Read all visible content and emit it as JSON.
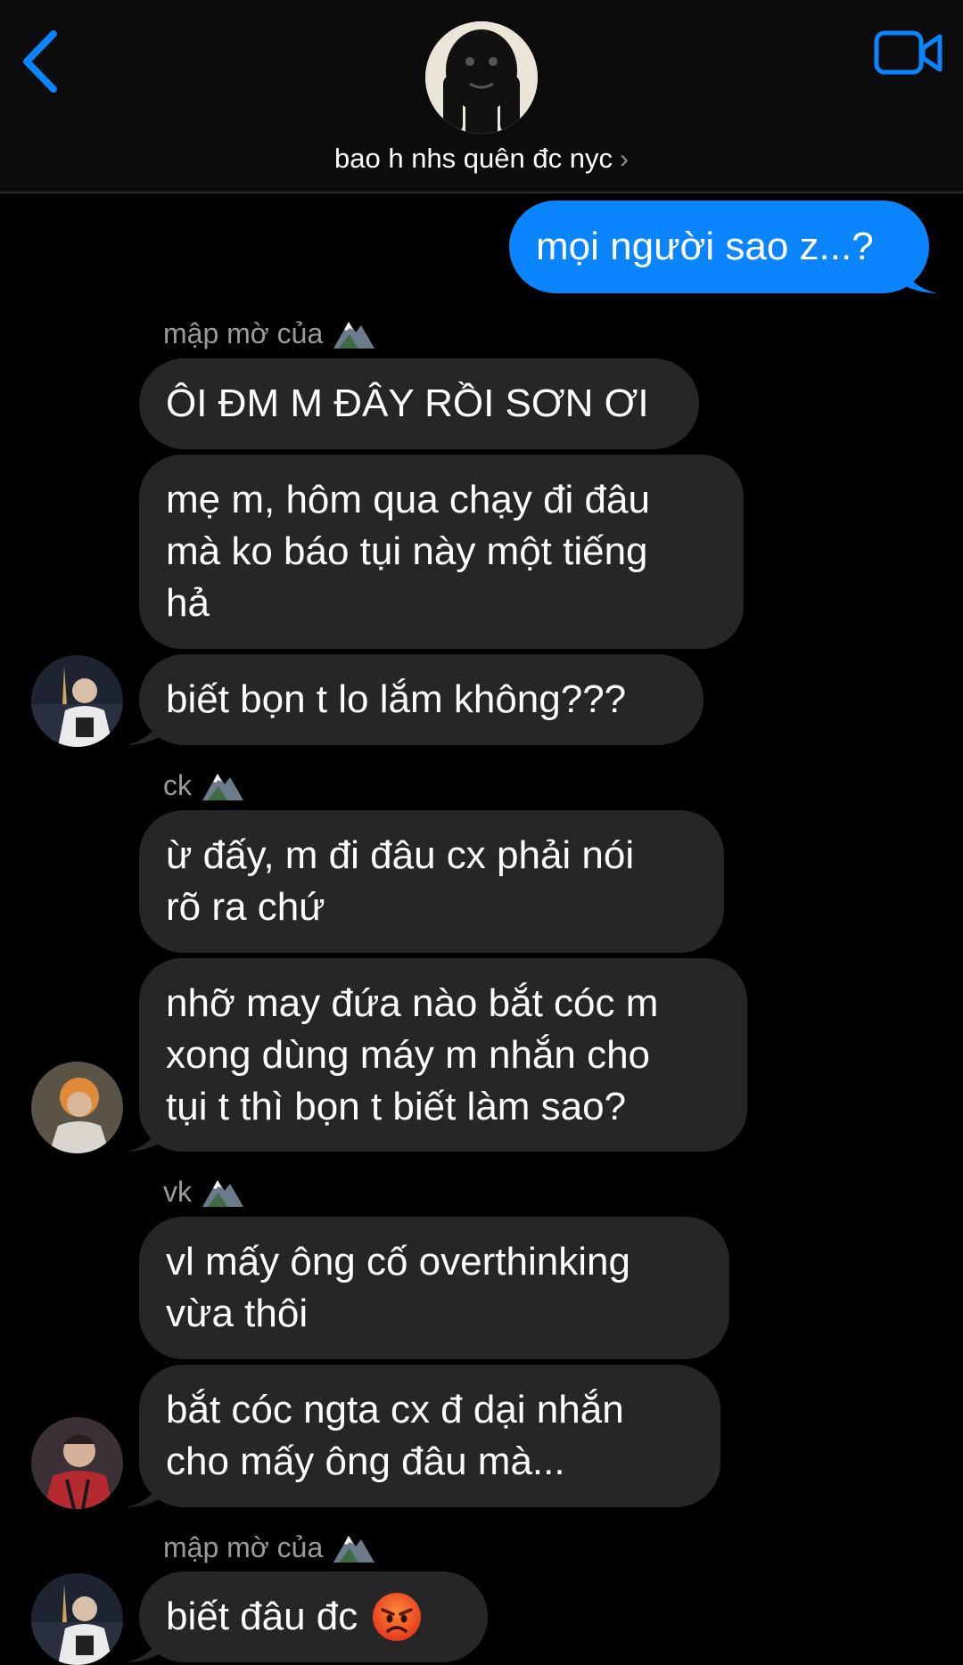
{
  "header": {
    "group_name": "bao h nhs quên đc nyc",
    "chevron": "›",
    "back_icon": "chevron-left-icon",
    "video_icon": "video-camera-icon",
    "accent_color": "#0a84ff"
  },
  "messages": [
    {
      "direction": "outgoing",
      "lines": [
        "mọi người sao z...?"
      ]
    },
    {
      "sender": "mập mờ của",
      "sender_emoji": "mountain-icon",
      "lines": [
        "ÔI ĐM M ĐÂY RỒI SƠN ƠI"
      ]
    },
    {
      "lines": [
        "mẹ m, hôm qua chạy đi đâu",
        "mà ko báo tụi này một tiếng",
        "hả"
      ]
    },
    {
      "lines": [
        "biết bọn t lo lắm không???"
      ]
    },
    {
      "sender": "ck",
      "sender_emoji": "mountain-icon",
      "lines": [
        "ừ đấy, m đi đâu cx phải nói",
        "rõ ra chứ"
      ]
    },
    {
      "lines": [
        "nhỡ may đứa nào bắt cóc m",
        "xong dùng máy m nhắn cho",
        "tụi t thì bọn t biết làm sao?"
      ]
    },
    {
      "sender": "vk",
      "sender_emoji": "mountain-icon",
      "lines": [
        "vl mấy ông cố overthinking",
        "vừa thôi"
      ]
    },
    {
      "lines": [
        "bắt cóc ngta cx đ dại nhắn",
        "cho mấy ông đâu mà..."
      ]
    },
    {
      "sender": "mập mờ của",
      "sender_emoji": "mountain-icon",
      "lines": [
        "biết đâu đc"
      ],
      "emoji": "pouting-face-icon"
    }
  ],
  "colors": {
    "background": "#000000",
    "incoming_bubble": "#262628",
    "outgoing_bubble": "#0a84ff",
    "sender_name": "#9a9a9e"
  }
}
